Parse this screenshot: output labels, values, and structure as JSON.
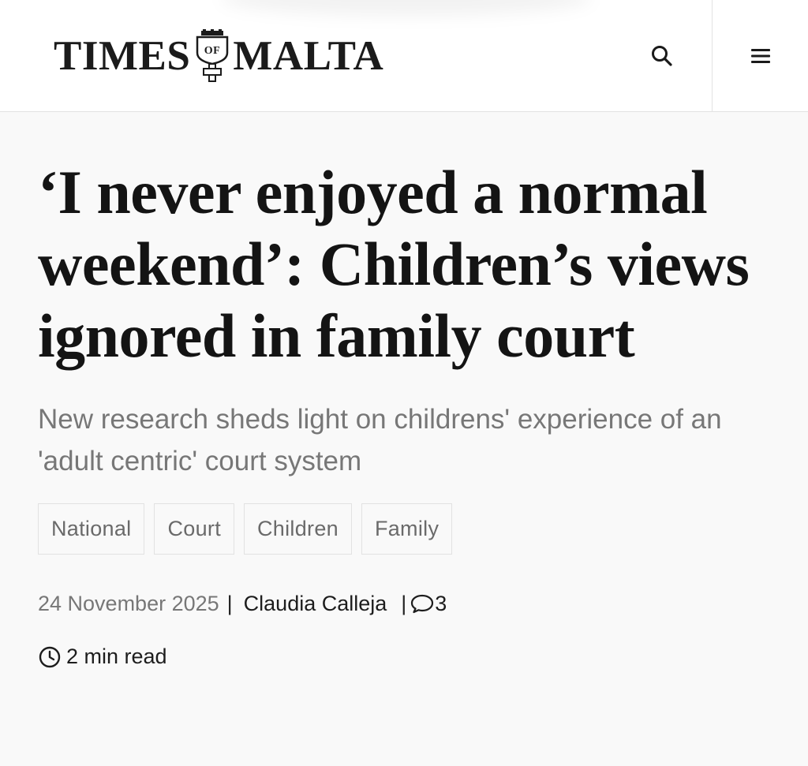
{
  "header": {
    "logo_left": "TIMES",
    "logo_crest_text": "OF",
    "logo_right": "MALTA",
    "search_icon": "search-icon",
    "menu_icon": "hamburger-menu-icon"
  },
  "article": {
    "headline": "‘I never enjoyed a normal weekend’: Children’s views ignored in family court",
    "subheadline": "New research sheds light on childrens' experience of an 'adult centric' court system",
    "tags": [
      "National",
      "Court",
      "Children",
      "Family"
    ],
    "date": "24 November 2025",
    "separator": "|",
    "author": "Claudia Calleja",
    "comment_count": "3",
    "read_time": "2 min read"
  },
  "colors": {
    "background": "#f9f9f9",
    "header_background": "#ffffff",
    "text": "#141414",
    "muted_text": "#777777",
    "border": "#e2e2e2"
  }
}
